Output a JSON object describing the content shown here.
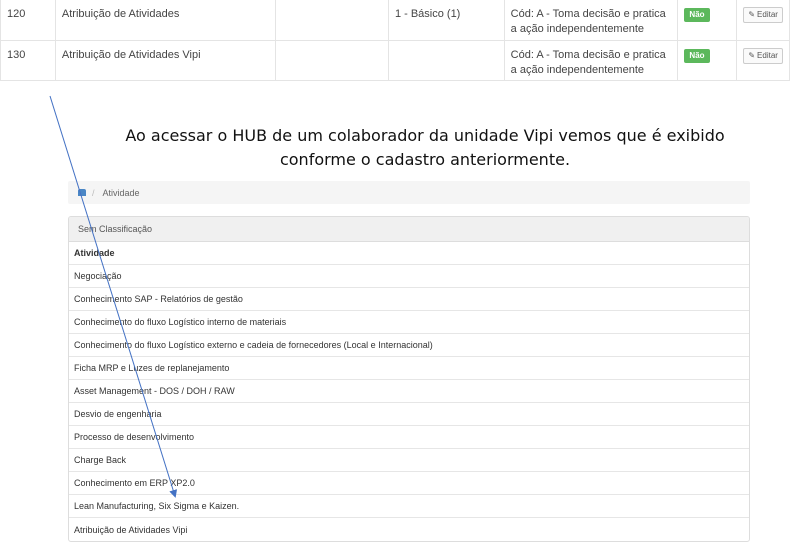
{
  "table": {
    "rows": [
      {
        "code": "120",
        "name": "Atribuição de Atividades",
        "level": "1 - Básico (1)",
        "classification": "Cód: A - Toma decisão e pratica a ação independentemente",
        "status": "Não",
        "edit_label": "Editar"
      },
      {
        "code": "130",
        "name": "Atribuição de Atividades Vipi",
        "level": "",
        "classification": "Cód: A - Toma decisão e pratica a ação independentemente",
        "status": "Não",
        "edit_label": "Editar"
      }
    ]
  },
  "caption": {
    "line1": "Ao acessar o HUB de um colaborador da unidade Vipi vemos que é exibido",
    "line2": "conforme o cadastro anteriormente."
  },
  "breadcrumb": {
    "separator": "/",
    "current": "Atividade"
  },
  "panel": {
    "title": "Sem Classificação",
    "column_header": "Atividade",
    "items": [
      "Negociação",
      "Conhecimento SAP - Relatórios de gestão",
      "Conhecimento do fluxo Logístico interno de materiais",
      "Conhecimento do fluxo Logístico externo e cadeia de fornecedores (Local e Internacional)",
      "Ficha MRP e Luzes de replanejamento",
      "Asset Management - DOS / DOH / RAW",
      "Desvio de engenharia",
      "Processo de desenvolvimento",
      "Charge Back",
      "Conhecimento em ERP XP2.0",
      "Lean Manufacturing, Six Sigma e Kaizen.",
      "Atribuição de Atividades Vipi"
    ]
  },
  "colors": {
    "badge": "#5cb85c",
    "arrow": "#4472c4",
    "home_icon": "#4a86c5"
  }
}
